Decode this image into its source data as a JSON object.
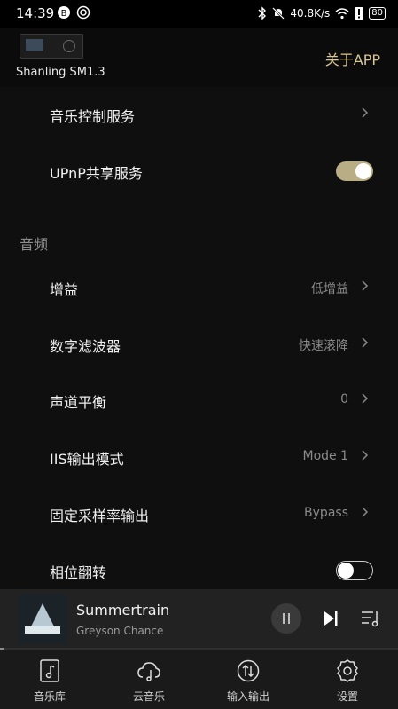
{
  "status_bar": {
    "time": "14:39",
    "network_speed": "40.8K/s",
    "battery": "80"
  },
  "header": {
    "device_name": "Shanling SM1.3",
    "about_link": "关于APP"
  },
  "settings": {
    "top_rows": [
      {
        "label": "音乐控制服务"
      },
      {
        "label": "UPnP共享服务",
        "toggle_on": true
      }
    ],
    "audio_section_title": "音频",
    "audio_rows": [
      {
        "label": "增益",
        "value": "低增益"
      },
      {
        "label": "数字滤波器",
        "value": "快速滚降"
      },
      {
        "label": "声道平衡",
        "value": "0"
      },
      {
        "label": "IIS输出模式",
        "value": "Mode 1"
      },
      {
        "label": "固定采样率输出",
        "value": "Bypass"
      },
      {
        "label": "相位翻转",
        "toggle_on": false
      }
    ]
  },
  "player": {
    "track_title": "Summertrain",
    "artist": "Greyson Chance",
    "progress": 0.01
  },
  "tab_bar": {
    "tabs": [
      {
        "label": "音乐库",
        "icon": "music-library-icon"
      },
      {
        "label": "云音乐",
        "icon": "cloud-music-icon"
      },
      {
        "label": "输入输出",
        "icon": "input-output-icon"
      },
      {
        "label": "设置",
        "icon": "settings-gear-icon"
      }
    ]
  },
  "colors": {
    "accent_gold": "#d9c691",
    "toggle_on": "#b9ad86",
    "background": "#0f0f0f"
  }
}
